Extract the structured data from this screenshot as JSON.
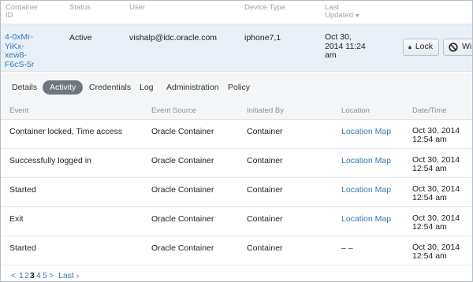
{
  "columns": {
    "container_id": "Container ID",
    "status": "Status",
    "user": "User",
    "device_type": "Device Type",
    "last_updated": "Last Updated"
  },
  "container": {
    "id": "4-0xMr-YiKx-xew8-F6cS-5r",
    "status": "Active",
    "user": "vishalp@idc.oracle.com",
    "device_type": "iphone7,1",
    "last_updated": "Oct 30, 2014 11:24 am"
  },
  "actions": {
    "lock_label": "Lock",
    "wipe_label": "Wi"
  },
  "tabs": [
    {
      "label": "Details"
    },
    {
      "label": "Activity",
      "active": true
    },
    {
      "label": "Credentials"
    },
    {
      "label": "Log"
    },
    {
      "label": "Administration"
    },
    {
      "label": "Policy"
    }
  ],
  "activity": {
    "headers": {
      "event": "Event",
      "source": "Event Source",
      "initiated_by": "Initiated By",
      "location": "Location",
      "datetime": "Date/Time"
    },
    "rows": [
      {
        "event": "Container locked, Time access",
        "source": "Oracle Container",
        "initiated_by": "Container",
        "location": "Location Map",
        "datetime": "Oct 30, 2014 12:54 am"
      },
      {
        "event": "Successfully logged in",
        "source": "Oracle Container",
        "initiated_by": "Container",
        "location": "Location Map",
        "datetime": "Oct 30, 2014 12:54 am"
      },
      {
        "event": "Started",
        "source": "Oracle Container",
        "initiated_by": "Container",
        "location": "Location Map",
        "datetime": "Oct 30, 2014 12:54 am"
      },
      {
        "event": "Exit",
        "source": "Oracle Container",
        "initiated_by": "Container",
        "location": "Location Map",
        "datetime": "Oct 30, 2014 12:54 am"
      },
      {
        "event": "Started",
        "source": "Oracle Container",
        "initiated_by": "Container",
        "location": "– –",
        "datetime": "Oct 30, 2014 12:54 am"
      }
    ]
  },
  "pagination": {
    "prev": "<",
    "pages": [
      "1",
      "2",
      "3",
      "4",
      "5"
    ],
    "current": "3",
    "next": ">",
    "last": "Last ›"
  },
  "icons": {
    "lock": "lock-icon",
    "wipe": "no-entry-icon",
    "sort": "sort-down-icon"
  },
  "colors": {
    "link": "#3a78b5",
    "active_tab": "#6f767e",
    "row_highlight": "#e9f0f7"
  }
}
